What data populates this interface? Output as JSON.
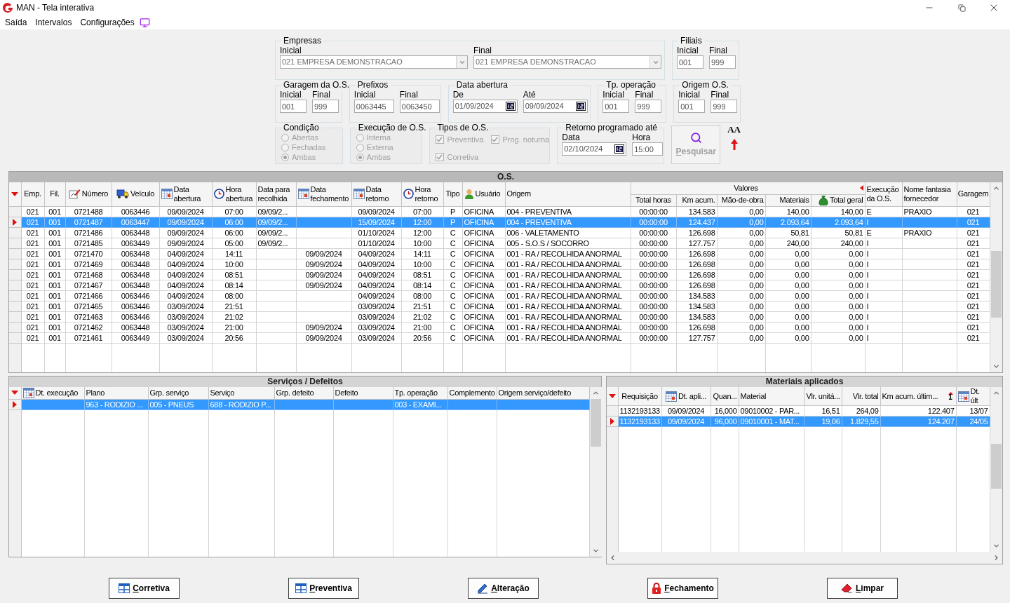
{
  "window": {
    "title": "MAN - Tela interativa"
  },
  "menu": [
    {
      "label": "Saída"
    },
    {
      "label": "Intervalos"
    },
    {
      "label": "Configurações"
    }
  ],
  "filters": {
    "groups": [
      {
        "legend": "Empresas",
        "kind": "fields",
        "fields": [
          {
            "label": "Inicial",
            "value": "021 EMPRESA DEMONSTRACAO",
            "kind": "combo"
          },
          {
            "label": "Final",
            "value": "021 EMPRESA DEMONSTRACAO",
            "kind": "combo"
          }
        ]
      },
      {
        "legend": "Filiais",
        "kind": "fields",
        "fields": [
          {
            "label": "Inicial",
            "value": "001",
            "kind": "text"
          },
          {
            "label": "Final",
            "value": "999",
            "kind": "text"
          }
        ]
      },
      {
        "legend": "Garagem da O.S.",
        "kind": "fields",
        "fields": [
          {
            "label": "Inicial",
            "value": "001",
            "kind": "text"
          },
          {
            "label": "Final",
            "value": "999",
            "kind": "text"
          }
        ]
      },
      {
        "legend": "Prefixos",
        "kind": "fields",
        "fields": [
          {
            "label": "Inicial",
            "value": "0063445",
            "kind": "text"
          },
          {
            "label": "Final",
            "value": "0063450",
            "kind": "text"
          }
        ]
      },
      {
        "legend": "Data abertura",
        "kind": "fields",
        "fields": [
          {
            "label": "De",
            "value": "01/09/2024",
            "kind": "date"
          },
          {
            "label": "Até",
            "value": "09/09/2024",
            "kind": "date"
          }
        ]
      },
      {
        "legend": "Tp. operação",
        "kind": "fields",
        "fields": [
          {
            "label": "Inicial",
            "value": "001",
            "kind": "text"
          },
          {
            "label": "Final",
            "value": "999",
            "kind": "text"
          }
        ]
      },
      {
        "legend": "Origem O.S.",
        "kind": "fields",
        "fields": [
          {
            "label": "Inicial",
            "value": "001",
            "kind": "text"
          },
          {
            "label": "Final",
            "value": "999",
            "kind": "text"
          }
        ]
      },
      {
        "legend": "Condição",
        "kind": "radios",
        "disabled": true,
        "options": [
          {
            "label": "Abertas",
            "selected": false
          },
          {
            "label": "Fechadas",
            "selected": false
          },
          {
            "label": "Ambas",
            "selected": true
          }
        ]
      },
      {
        "legend": "Execução de O.S.",
        "kind": "radios",
        "disabled": true,
        "options": [
          {
            "label": "Interna",
            "selected": false
          },
          {
            "label": "Externa",
            "selected": false
          },
          {
            "label": "Ambas",
            "selected": true
          }
        ]
      },
      {
        "legend": "Tipos de O.S.",
        "kind": "checks",
        "disabled": true,
        "options": [
          {
            "label": "Preventiva",
            "checked": true
          },
          {
            "label": "Prog. noturna",
            "checked": true
          },
          {
            "label": "Corretiva",
            "checked": true
          }
        ]
      },
      {
        "legend": "Retorno programado até",
        "kind": "fields",
        "fields": [
          {
            "label": "Data",
            "value": "02/10/2024",
            "kind": "date"
          },
          {
            "label": "Hora",
            "value": "15:00",
            "kind": "text"
          }
        ]
      }
    ],
    "search_button": {
      "label": "Pesquisar",
      "disabled": true
    },
    "font_button": {
      "label": "AA"
    }
  },
  "os_grid": {
    "title": "O.S.",
    "columns": [
      {
        "label": "Emp.",
        "kind": "plain"
      },
      {
        "label": "Fil.",
        "kind": "plain"
      },
      {
        "label": "Número",
        "kind": "edit"
      },
      {
        "label": "Veículo",
        "kind": "truck"
      },
      {
        "label": "Data abertura",
        "kind": "calendar"
      },
      {
        "label": "Hora abertura",
        "kind": "clock"
      },
      {
        "label": "Data para recolhida",
        "kind": "plain"
      },
      {
        "label": "Data fechamento",
        "kind": "calendar"
      },
      {
        "label": "Data retorno",
        "kind": "calendar"
      },
      {
        "label": "Hora retorno",
        "kind": "clock"
      },
      {
        "label": "Tipo",
        "kind": "plain"
      },
      {
        "label": "Usuário",
        "kind": "user"
      },
      {
        "label": "Origem",
        "kind": "plain"
      },
      {
        "label": "Valores",
        "colspan": 5,
        "children": [
          {
            "label": "Total horas",
            "kind": "plain"
          },
          {
            "label": "Km acum.",
            "kind": "plain"
          },
          {
            "label": "Mão-de-obra",
            "kind": "plain"
          },
          {
            "label": "Materiais",
            "kind": "plain"
          },
          {
            "label": "Total geral",
            "kind": "money"
          }
        ]
      },
      {
        "label": "Execução da O.S.",
        "kind": "plain"
      },
      {
        "label": "Nome fantasia fornecedor",
        "kind": "plain"
      },
      {
        "label": "Garagem",
        "kind": "plain"
      }
    ],
    "rows": [
      {
        "selected": false,
        "cells": [
          "021",
          "001",
          "0721488",
          "0063446",
          "09/09/2024",
          "07:00",
          "09/09/2...",
          null,
          "09/09/2024",
          "07:00",
          "P",
          "OFICINA",
          "004 - PREVENTIVA",
          "00:00:00",
          "134.583",
          "0,00",
          "140,00",
          "140,00",
          "E",
          "PRAXIO",
          "021"
        ]
      },
      {
        "selected": true,
        "cells": [
          "021",
          "001",
          "0721487",
          "0063447",
          "09/09/2024",
          "06:00",
          "09/09/2...",
          null,
          "15/09/2024",
          "12:00",
          "P",
          "OFICINA",
          "004 - PREVENTIVA",
          "00:00:00",
          "124.437",
          "0,00",
          "2.093,64",
          "2.093,64",
          "I",
          null,
          "021"
        ]
      },
      {
        "selected": false,
        "cells": [
          "021",
          "001",
          "0721486",
          "0063448",
          "09/09/2024",
          "06:00",
          "09/09/2...",
          null,
          "01/10/2024",
          "12:00",
          "C",
          "OFICINA",
          "006 - VALETAMENTO",
          "00:00:00",
          "126.698",
          "0,00",
          "50,81",
          "50,81",
          "E",
          "PRAXIO",
          "021"
        ]
      },
      {
        "selected": false,
        "cells": [
          "021",
          "001",
          "0721485",
          "0063449",
          "09/09/2024",
          "05:00",
          "09/09/2...",
          null,
          "01/10/2024",
          "10:00",
          "C",
          "OFICINA",
          "005 - S.O.S / SOCORRO",
          "00:00:00",
          "127.757",
          "0,00",
          "240,00",
          "240,00",
          "I",
          null,
          "021"
        ]
      },
      {
        "selected": false,
        "cells": [
          "021",
          "001",
          "0721470",
          "0063448",
          "04/09/2024",
          "14:11",
          null,
          "09/09/2024",
          "04/09/2024",
          "14:11",
          "C",
          "OFICINA",
          "001 - RA / RECOLHIDA ANORMAL",
          "00:00:00",
          "126.698",
          "0,00",
          "0,00",
          "0,00",
          "I",
          null,
          "021"
        ]
      },
      {
        "selected": false,
        "cells": [
          "021",
          "001",
          "0721469",
          "0063448",
          "04/09/2024",
          "10:00",
          null,
          "09/09/2024",
          "04/09/2024",
          "10:00",
          "C",
          "OFICINA",
          "001 - RA / RECOLHIDA ANORMAL",
          "00:00:00",
          "126.698",
          "0,00",
          "0,00",
          "0,00",
          "I",
          null,
          "021"
        ]
      },
      {
        "selected": false,
        "cells": [
          "021",
          "001",
          "0721468",
          "0063448",
          "04/09/2024",
          "08:51",
          null,
          "09/09/2024",
          "04/09/2024",
          "08:51",
          "C",
          "OFICINA",
          "001 - RA / RECOLHIDA ANORMAL",
          "00:00:00",
          "126.698",
          "0,00",
          "0,00",
          "0,00",
          "I",
          null,
          "021"
        ]
      },
      {
        "selected": false,
        "cells": [
          "021",
          "001",
          "0721467",
          "0063448",
          "04/09/2024",
          "08:14",
          null,
          "09/09/2024",
          "04/09/2024",
          "08:14",
          "C",
          "OFICINA",
          "001 - RA / RECOLHIDA ANORMAL",
          "00:00:00",
          "126.698",
          "0,00",
          "0,00",
          "0,00",
          "I",
          null,
          "021"
        ]
      },
      {
        "selected": false,
        "cells": [
          "021",
          "001",
          "0721466",
          "0063446",
          "04/09/2024",
          "08:00",
          null,
          null,
          "04/09/2024",
          "08:00",
          "C",
          "OFICINA",
          "001 - RA / RECOLHIDA ANORMAL",
          "00:00:00",
          "134.583",
          "0,00",
          "0,00",
          "0,00",
          "I",
          null,
          "021"
        ]
      },
      {
        "selected": false,
        "cells": [
          "021",
          "001",
          "0721465",
          "0063446",
          "03/09/2024",
          "21:51",
          null,
          null,
          "03/09/2024",
          "21:51",
          "C",
          "OFICINA",
          "001 - RA / RECOLHIDA ANORMAL",
          "00:00:00",
          "134.583",
          "0,00",
          "0,00",
          "0,00",
          "I",
          null,
          "021"
        ]
      },
      {
        "selected": false,
        "cells": [
          "021",
          "001",
          "0721463",
          "0063446",
          "03/09/2024",
          "21:02",
          null,
          null,
          "03/09/2024",
          "21:02",
          "C",
          "OFICINA",
          "001 - RA / RECOLHIDA ANORMAL",
          "00:00:00",
          "134.583",
          "0,00",
          "0,00",
          "0,00",
          "I",
          null,
          "021"
        ]
      },
      {
        "selected": false,
        "cells": [
          "021",
          "001",
          "0721462",
          "0063448",
          "03/09/2024",
          "21:00",
          null,
          "09/09/2024",
          "03/09/2024",
          "21:00",
          "C",
          "OFICINA",
          "001 - RA / RECOLHIDA ANORMAL",
          "00:00:00",
          "126.698",
          "0,00",
          "0,00",
          "0,00",
          "I",
          null,
          "021"
        ]
      },
      {
        "selected": false,
        "cells": [
          "021",
          "001",
          "0721461",
          "0063449",
          "03/09/2024",
          "20:56",
          null,
          "09/09/2024",
          "03/09/2024",
          "20:56",
          "C",
          "OFICINA",
          "001 - RA / RECOLHIDA ANORMAL",
          "00:00:00",
          "127.757",
          "0,00",
          "0,00",
          "0,00",
          "I",
          null,
          "021"
        ]
      }
    ]
  },
  "services_grid": {
    "title": "Serviços / Defeitos",
    "columns": [
      {
        "label": "Dt. execução",
        "kind": "calendar"
      },
      {
        "label": "Plano",
        "kind": "plain"
      },
      {
        "label": "Grp. serviço",
        "kind": "plain"
      },
      {
        "label": "Serviço",
        "kind": "plain"
      },
      {
        "label": "Grp. defeito",
        "kind": "plain"
      },
      {
        "label": "Defeito",
        "kind": "plain"
      },
      {
        "label": "Tp. operação",
        "kind": "plain"
      },
      {
        "label": "Complemento",
        "kind": "plain"
      },
      {
        "label": "Origem serviço/defeito",
        "kind": "plain"
      }
    ],
    "rows": [
      {
        "selected": true,
        "cells": [
          null,
          "963 - RODIZIO ...",
          "005 - PNEUS",
          "688 - RODIZIO P...",
          null,
          null,
          "003 - EXAMI...",
          null,
          null
        ]
      }
    ]
  },
  "materials_grid": {
    "title": "Materiais aplicados",
    "columns": [
      {
        "label": "Requisição",
        "kind": "plain"
      },
      {
        "label": "Dt. apli...",
        "kind": "calendar"
      },
      {
        "label": "Quan...",
        "kind": "plain"
      },
      {
        "label": "Material",
        "kind": "plain"
      },
      {
        "label": "Vlr. unitá...",
        "kind": "plain"
      },
      {
        "label": "Vlr. total",
        "kind": "plain"
      },
      {
        "label": "Km acum. últim...",
        "kind": "sorted",
        "badge": "1"
      },
      {
        "label": "Dt. últ",
        "kind": "calendar"
      }
    ],
    "rows": [
      {
        "selected": false,
        "cells": [
          "1132193133",
          "09/09/2024",
          "16,000",
          "09010002 - PAR...",
          "16,51",
          "264,09",
          "122.407",
          "13/07"
        ]
      },
      {
        "selected": true,
        "cells": [
          "1132193133",
          "09/09/2024",
          "96,000",
          "09010001 - MAT...",
          "19,06",
          "1.829,55",
          "124.207",
          "24/05"
        ]
      }
    ]
  },
  "buttons": [
    {
      "label": "Corretiva"
    },
    {
      "label": "Preventiva"
    },
    {
      "label": "Alteração"
    },
    {
      "label": "Fechamento"
    },
    {
      "label": "Limpar"
    }
  ]
}
